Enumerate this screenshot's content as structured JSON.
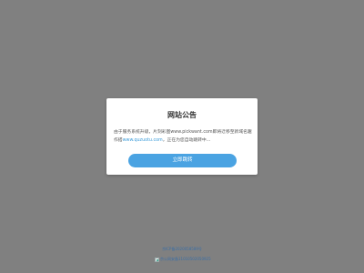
{
  "modal": {
    "title": "网站公告",
    "body_prefix": "由于服务系统升级，片刻彩图www.pickwant.com即将迁移至新域名趣作搭",
    "link_text": "www.quzuotu.com",
    "body_suffix": "，正在为您自动跳转中...",
    "jump_label": "立即跳转"
  },
  "footer": {
    "icp_text": "京ICP备2020058589号",
    "police_text": "京公网安备11010502050925"
  },
  "colors": {
    "background": "#808080",
    "accent": "#4aa3e2",
    "link": "#3a9bd9"
  }
}
